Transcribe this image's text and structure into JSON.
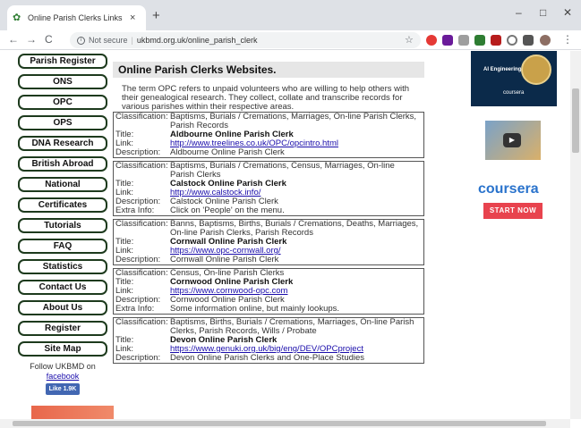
{
  "browser": {
    "tab_title": "Online Parish Clerks Links UKBMD",
    "tab_close": "×",
    "new_tab": "+",
    "win_min": "–",
    "win_max": "□",
    "win_close": "✕",
    "back": "←",
    "forward": "→",
    "reload": "C",
    "info_glyph": "i",
    "not_secure": "Not secure",
    "separator": "|",
    "url": "ukbmd.org.uk/online_parish_clerk",
    "star": "☆",
    "menu": "⋮"
  },
  "sidebar": {
    "items": [
      {
        "label": "Parish Register"
      },
      {
        "label": "ONS"
      },
      {
        "label": "OPC"
      },
      {
        "label": "OPS"
      },
      {
        "label": "DNA Research"
      },
      {
        "label": "British Abroad"
      },
      {
        "label": "National"
      },
      {
        "label": "Certificates"
      },
      {
        "label": "Tutorials"
      },
      {
        "label": "FAQ"
      },
      {
        "label": "Statistics"
      },
      {
        "label": "Contact Us"
      },
      {
        "label": "About Us"
      },
      {
        "label": "Register"
      },
      {
        "label": "Site Map"
      }
    ],
    "follow_text": "Follow UKBMD on",
    "facebook_link": "facebook",
    "like_label": "Like 1.9K"
  },
  "main": {
    "heading": "Online Parish Clerks Websites.",
    "intro": "The term OPC refers to unpaid volunteers who are willing to help others with their genealogical research. They collect, collate and transcribe records for various parishes within their respective areas.",
    "labels": {
      "classification": "Classification:",
      "title": "Title:",
      "link": "Link:",
      "description": "Description:",
      "extra": "Extra Info:"
    },
    "entries": [
      {
        "classification": "Baptisms, Burials / Cremations, Marriages, On-line Parish Clerks, Parish Records",
        "title": "Aldbourne Online Parish Clerk",
        "link": "http://www.treelines.co.uk/OPC/opcintro.html",
        "description": "Aldbourne Online Parish Clerk",
        "extra": ""
      },
      {
        "classification": "Baptisms, Burials / Cremations, Census, Marriages, On-line Parish Clerks",
        "title": "Calstock Online Parish Clerk",
        "link": "http://www.calstock.info/",
        "description": "Calstock Online Parish Clerk",
        "extra": "Click on 'People' on the menu."
      },
      {
        "classification": "Banns, Baptisms, Births, Burials / Cremations, Deaths, Marriages, On-line Parish Clerks, Parish Records",
        "title": "Cornwall Online Parish Clerk",
        "link": "https://www.opc-cornwall.org/",
        "description": "Cornwall Online Parish Clerk",
        "extra": ""
      },
      {
        "classification": "Census, On-line Parish Clerks",
        "title": "Cornwood Online Parish Clerk",
        "link": "https://www.cornwood-opc.com",
        "description": "Cornwood Online Parish Clerk",
        "extra": "Some information online, but mainly lookups."
      },
      {
        "classification": "Baptisms, Births, Burials / Cremations, Marriages, On-line Parish Clerks, Parish Records, Wills / Probate",
        "title": "Devon Online Parish Clerk",
        "link": "https://www.genuki.org.uk/big/eng/DEV/OPCproject",
        "description": "Devon Online Parish Clerks and One-Place Studies",
        "extra": ""
      }
    ]
  },
  "ad": {
    "badge_text": "AI Engineering",
    "brand_small": "coursera",
    "brand": "coursera",
    "cta": "START NOW",
    "play_glyph": "▶"
  },
  "colors": {
    "nav_border": "#1d3a1d",
    "heading_bg": "#e6e6e6",
    "link": "#1a0dab",
    "coursera_blue": "#2a73cc",
    "cta_red": "#e8434e"
  }
}
